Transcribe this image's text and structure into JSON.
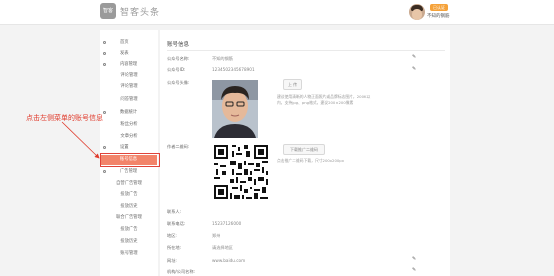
{
  "header": {
    "logo_text": "智客",
    "brand": "智客头条",
    "badge": "已认证",
    "username": "不知的钢筋"
  },
  "sidebar": {
    "items": [
      {
        "label": "首页",
        "type": "group"
      },
      {
        "label": "发表",
        "type": "group"
      },
      {
        "label": "内容管理",
        "type": "group"
      },
      {
        "label": "评论管理",
        "type": "sub"
      },
      {
        "label": "评论管理",
        "type": "sub"
      },
      {
        "label": "问答管理",
        "type": "sub"
      },
      {
        "label": "数据统计",
        "type": "group"
      },
      {
        "label": "粉丝分析",
        "type": "sub"
      },
      {
        "label": "文章分析",
        "type": "sub"
      },
      {
        "label": "设置",
        "type": "group"
      },
      {
        "label": "账号信息",
        "type": "active"
      },
      {
        "label": "广告管理",
        "type": "group"
      },
      {
        "label": "自营广告管理",
        "type": "sub"
      },
      {
        "label": "投放广告",
        "type": "sub"
      },
      {
        "label": "投放历史",
        "type": "sub"
      },
      {
        "label": "联合广告管理",
        "type": "sub"
      },
      {
        "label": "投放广告",
        "type": "sub"
      },
      {
        "label": "投放历史",
        "type": "sub"
      },
      {
        "label": "账号管理",
        "type": "sub"
      }
    ]
  },
  "content": {
    "title": "账号信息",
    "fields": [
      {
        "label": "公众号名称:",
        "value": "不知的钢筋"
      },
      {
        "label": "公众号ID:",
        "value": "1234502345678901"
      },
      {
        "label": "公众号头像:",
        "value": ""
      },
      {
        "label": "作者二维码:",
        "value": ""
      },
      {
        "label": "联系人:",
        "value": ""
      },
      {
        "label": "联系电话:",
        "value": "15237126000"
      },
      {
        "label": "地区:",
        "value": "郑州"
      },
      {
        "label": "所在地:",
        "value": "请选择地区"
      },
      {
        "label": "网址:",
        "value": "www.baidu.com"
      },
      {
        "label": "机构/公司名称:",
        "value": ""
      }
    ],
    "avatar_button": "上 传",
    "avatar_hint": [
      "建议使用清晰的人物正面照片或品牌标志图片，200K以",
      "内，支持jpg、png格式，建议200×200像素"
    ],
    "qr_button": "下载推广二维码",
    "qr_hint": "点击推广二维码下载，尺寸200x200px"
  },
  "annotation": {
    "text": "点击左侧菜单的账号信息",
    "color": "#e03a2b"
  },
  "colors": {
    "active_bg": "#f2846a",
    "badge_bg": "#f5a23a"
  }
}
